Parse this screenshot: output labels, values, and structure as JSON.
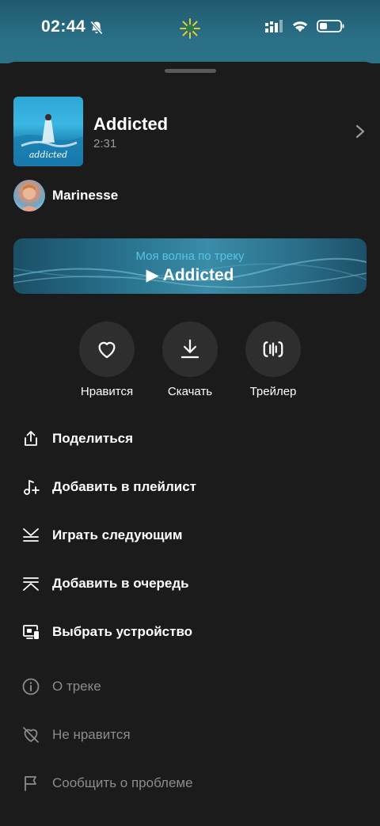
{
  "status_bar": {
    "time": "02:44",
    "icons": [
      "mute-bell-icon",
      "sun-icon",
      "signal-icon",
      "wifi-icon",
      "battery-icon"
    ]
  },
  "track": {
    "cover_text": "addicted",
    "title": "Addicted",
    "duration": "2:31"
  },
  "artist": {
    "name": "Marinesse"
  },
  "wave": {
    "subtitle": "Моя волна по треку",
    "title": "▶ Addicted"
  },
  "actions": [
    {
      "label": "Нравится",
      "icon": "heart-icon"
    },
    {
      "label": "Скачать",
      "icon": "download-icon"
    },
    {
      "label": "Трейлер",
      "icon": "trailer-icon"
    }
  ],
  "menu": {
    "share": "Поделиться",
    "add_playlist": "Добавить в плейлист",
    "play_next": "Играть следующим",
    "add_queue": "Добавить в очередь",
    "choose_device": "Выбрать устройство",
    "about_track": "О треке",
    "dislike": "Не нравится",
    "report": "Сообщить о проблеме"
  },
  "colors": {
    "background": "#1b1b1b",
    "accent_cyan": "#57c4e6",
    "dim_text": "#8c8c8c",
    "action_circle": "#2e2e2e"
  }
}
